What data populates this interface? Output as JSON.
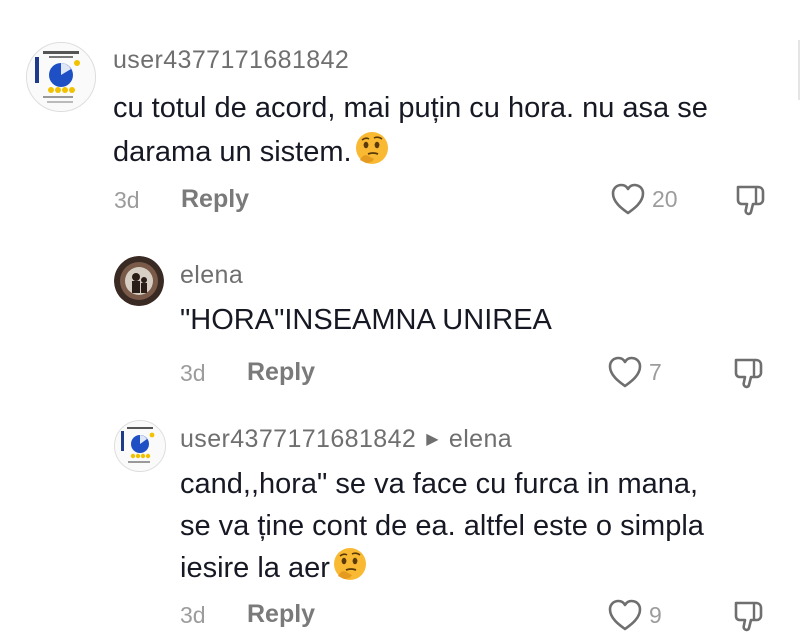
{
  "comments": [
    {
      "username": "user4377171681842",
      "text_lines": [
        "cu totul de acord, mai puțin cu hora. nu asa se",
        "darama un sistem."
      ],
      "emoji_name": "thinking-face-emoji",
      "time": "3d",
      "reply_label": "Reply",
      "likes": "20"
    },
    {
      "username": "elena",
      "text_lines": [
        "\"HORA\"INSEAMNA UNIREA"
      ],
      "time": "3d",
      "reply_label": "Reply",
      "likes": "7"
    },
    {
      "username": "user4377171681842",
      "reply_to": "elena",
      "text_lines": [
        "cand,,hora\" se va face cu furca in mana,",
        "se va ține cont de ea. altfel este o simpla",
        "iesire la aer"
      ],
      "emoji_name": "thinking-face-emoji",
      "time": "3d",
      "reply_label": "Reply",
      "likes": "9"
    }
  ],
  "icons": {
    "heart": "heart-outline-icon",
    "dislike": "thumbs-down-icon",
    "reply_arrow": "play-arrow-icon"
  },
  "colors": {
    "text": "#161823",
    "muted": "#9c9c9c",
    "username": "#6f6f6f"
  }
}
